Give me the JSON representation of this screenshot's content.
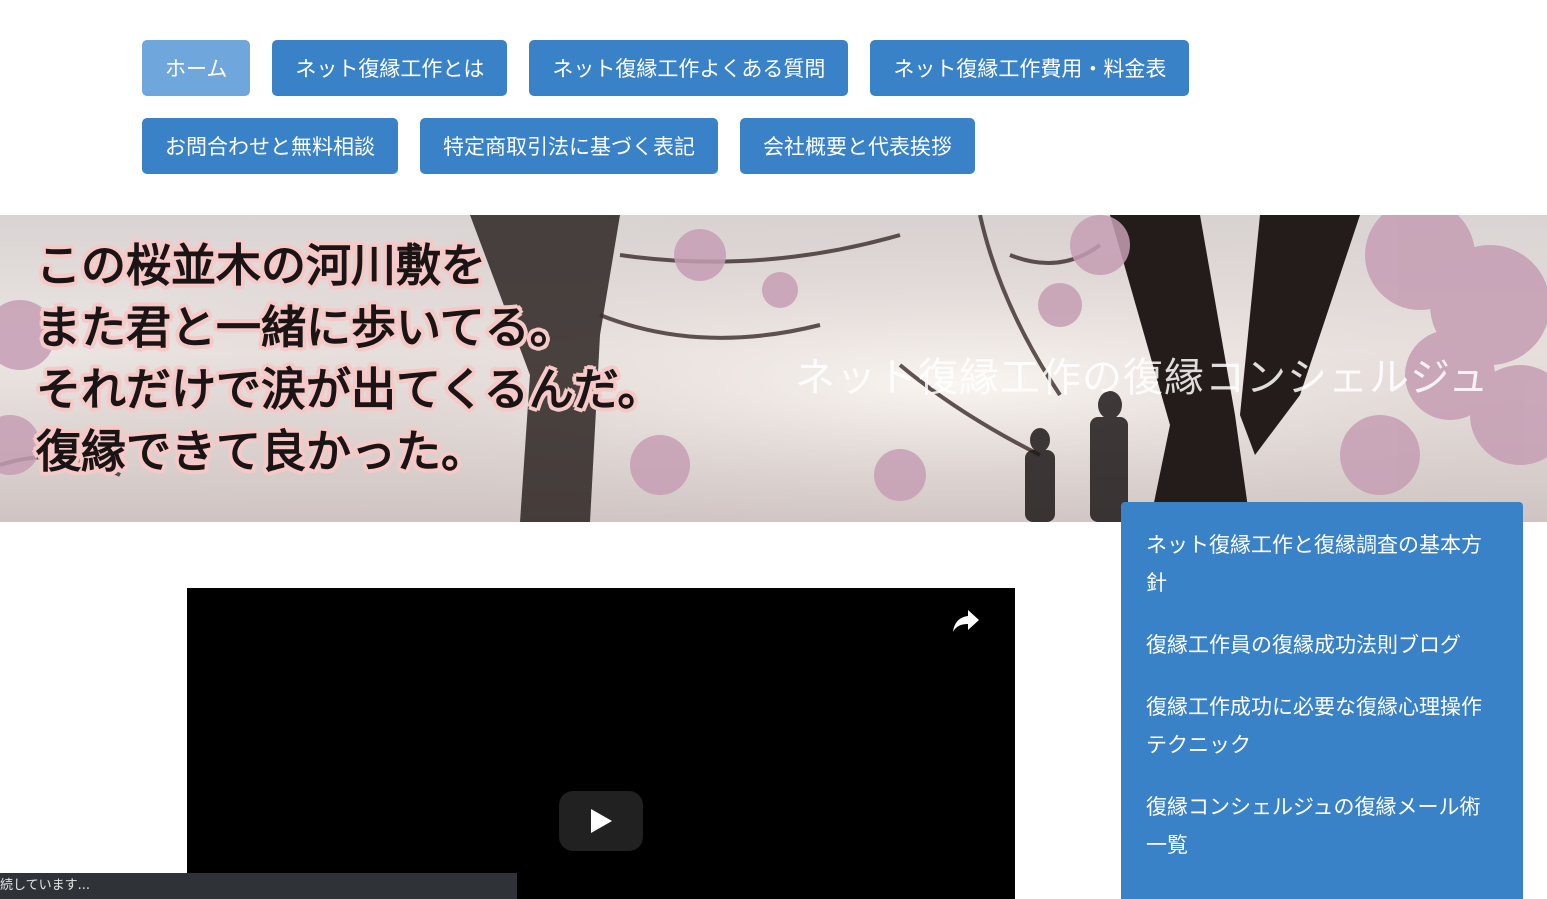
{
  "nav": {
    "row1": [
      {
        "label": "ホーム",
        "active": true
      },
      {
        "label": "ネット復縁工作とは",
        "active": false
      },
      {
        "label": "ネット復縁工作よくある質問",
        "active": false
      },
      {
        "label": "ネット復縁工作費用・料金表",
        "active": false
      }
    ],
    "row2": [
      {
        "label": "お問合わせと無料相談",
        "active": false
      },
      {
        "label": "特定商取引法に基づく表記",
        "active": false
      },
      {
        "label": "会社概要と代表挨拶",
        "active": false
      }
    ]
  },
  "hero": {
    "lines": [
      "この桜並木の河川敷を",
      "また君と一緒に歩いてる。",
      "それだけで涙が出てくるんだ。",
      "復縁できて良かった。"
    ],
    "site_title": "ネット復縁工作の復縁コンシェルジュ"
  },
  "video": {
    "share_icon": "share-arrow-icon",
    "play_icon": "play-icon"
  },
  "side_menu": {
    "items": [
      "ネット復縁工作と復縁調査の基本方針",
      "復縁工作員の復縁成功法則ブログ",
      "復縁工作成功に必要な復縁心理操作テクニック",
      "復縁コンシェルジュの復縁メール術一覧"
    ]
  },
  "status_bar": {
    "text": "続しています..."
  },
  "colors": {
    "nav_button": "#3a82c8",
    "nav_button_active": "#6fa6dc",
    "side_menu": "#3a82c8",
    "hero_text_outline": "#f6c9c9"
  }
}
